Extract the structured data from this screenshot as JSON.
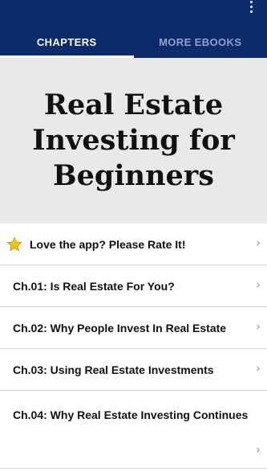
{
  "tabs": [
    {
      "label": "CHAPTERS",
      "active": true
    },
    {
      "label": "MORE EBOOKS",
      "active": false
    }
  ],
  "hero": {
    "title": "Real Estate Investing for Beginners"
  },
  "rate_row": {
    "label": "Love the app? Please Rate It!",
    "icon": "star-icon"
  },
  "chapters": [
    {
      "label": "Ch.01: Is Real Estate For You?"
    },
    {
      "label": "Ch.02: Why People Invest In Real Estate"
    },
    {
      "label": "Ch.03: Using Real Estate Investments"
    },
    {
      "label": "Ch.04: Why Real Estate Investing Continues"
    }
  ],
  "colors": {
    "app_bar": "#0b2b6b",
    "hero_bg": "#e9e9ec",
    "star": "#f4c20d"
  }
}
